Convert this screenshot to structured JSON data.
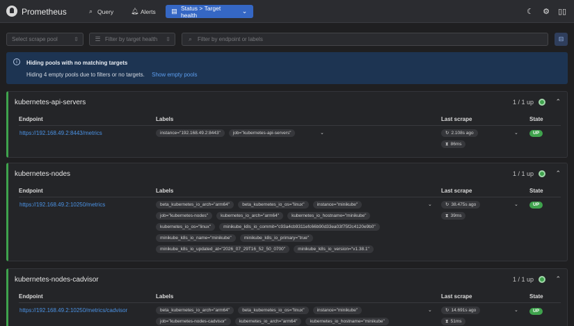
{
  "header": {
    "brand": "Prometheus",
    "nav": [
      {
        "label": "Query",
        "icon": "search-icon"
      },
      {
        "label": "Alerts",
        "icon": "bell-icon"
      },
      {
        "label": "Status > Target health",
        "icon": "server-icon"
      }
    ],
    "icons": [
      "moon-icon",
      "gear-icon",
      "book-icon"
    ]
  },
  "filters": {
    "scrape_pool_placeholder": "Select scrape pool",
    "target_health_placeholder": "Filter by target health",
    "endpoint_placeholder": "Filter by endpoint or labels"
  },
  "banner": {
    "title": "Hiding pools with no matching targets",
    "text": "Hiding 4 empty pools due to filters or no targets.",
    "link": "Show empty pools"
  },
  "table_headers": {
    "endpoint": "Endpoint",
    "labels": "Labels",
    "last_scrape": "Last scrape",
    "state": "State"
  },
  "pools": [
    {
      "name": "kubernetes-api-servers",
      "count": "1 / 1 up",
      "endpoint": "https://192.168.49.2:8443/metrics",
      "labels": [
        "instance=\"192.168.49.2:8443\"",
        "job=\"kubernetes-api-servers\""
      ],
      "last_scrape": "2.108s ago",
      "duration": "86ms",
      "state": "UP"
    },
    {
      "name": "kubernetes-nodes",
      "count": "1 / 1 up",
      "endpoint": "https://192.168.49.2:10250/metrics",
      "labels": [
        "beta_kubernetes_io_arch=\"arm64\"",
        "beta_kubernetes_io_os=\"linux\"",
        "instance=\"minikube\"",
        "job=\"kubernetes-nodes\"",
        "kubernetes_io_arch=\"arm64\"",
        "kubernetes_io_hostname=\"minikube\"",
        "kubernetes_io_os=\"linux\"",
        "minikube_k8s_io_commit=\"c93a4cb9311efc66b90d33ea03f75f2c4120e9b0\"",
        "minikube_k8s_io_name=\"minikube\"",
        "minikube_k8s_io_primary=\"true\"",
        "minikube_k8s_io_updated_at=\"2026_07_29T16_52_50_0700\"",
        "minikube_k8s_io_version=\"v1.38.1\""
      ],
      "last_scrape": "38.475s ago",
      "duration": "39ms",
      "state": "UP"
    },
    {
      "name": "kubernetes-nodes-cadvisor",
      "count": "1 / 1 up",
      "endpoint": "https://192.168.49.2:10250/metrics/cadvisor",
      "labels": [
        "beta_kubernetes_io_arch=\"arm64\"",
        "beta_kubernetes_io_os=\"linux\"",
        "instance=\"minikube\"",
        "job=\"kubernetes-nodes-cadvisor\"",
        "kubernetes_io_arch=\"arm64\"",
        "kubernetes_io_hostname=\"minikube\""
      ],
      "last_scrape": "14.691s ago",
      "duration": "51ms",
      "state": "UP"
    }
  ]
}
